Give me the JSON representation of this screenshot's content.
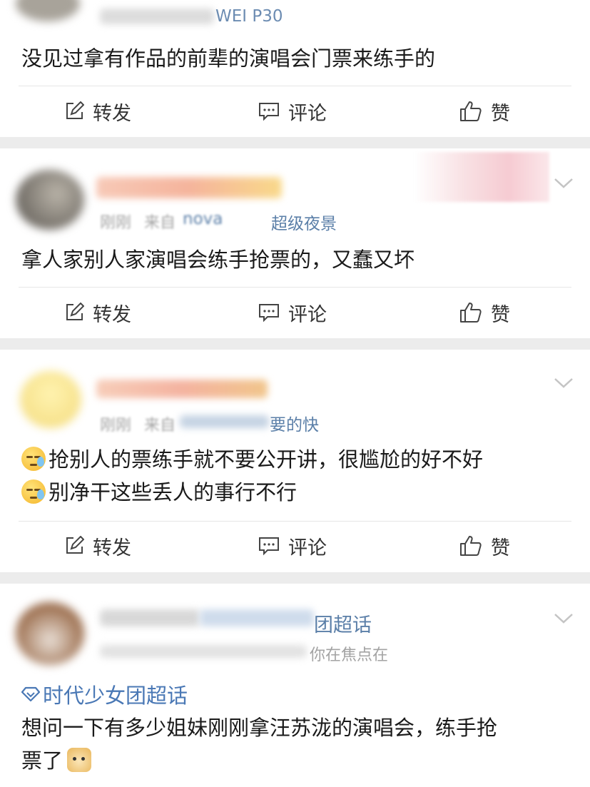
{
  "posts": [
    {
      "source_tail": "WEI P30",
      "text": "没见过拿有作品的前辈的演唱会门票来练手的",
      "actions": {
        "repost": "转发",
        "comment": "评论",
        "like": "赞"
      }
    },
    {
      "source_time": "刚刚",
      "source_prefix": "来自",
      "source_visible": "nova",
      "source_suffix": "超级夜景",
      "text": "拿人家别人家演唱会练手抢票的，又蠢又坏",
      "actions": {
        "repost": "转发",
        "comment": "评论",
        "like": "赞"
      }
    },
    {
      "source_time": "刚刚",
      "source_prefix": "来自",
      "source_suffix": "要的快",
      "text_line1": "抢别人的票练手就不要公开讲，很尴尬的好不好",
      "text_line2": "别净干这些丢人的事行不行",
      "actions": {
        "repost": "转发",
        "comment": "评论",
        "like": "赞"
      }
    },
    {
      "name_suffix": "团超话",
      "source_suffix": "你在焦点在",
      "topic": "时代少女团超话",
      "text_line1": "想问一下有多少姐妹刚刚拿汪苏泷的演唱会，练手抢",
      "text_line2": "票了"
    }
  ],
  "icons": {
    "repost": "edit-square-icon",
    "comment": "comment-bubble-icon",
    "like": "thumbs-up-icon",
    "more": "chevron-down-icon",
    "topic": "diamond-topic-icon",
    "emoji_sweat": "sweat-emoji-icon",
    "emoji_doge": "doge-emoji-icon"
  },
  "colors": {
    "link": "#5b7fa8",
    "topic": "#4a78b5",
    "text": "#1a1a1a",
    "background": "#f1f1f1"
  }
}
